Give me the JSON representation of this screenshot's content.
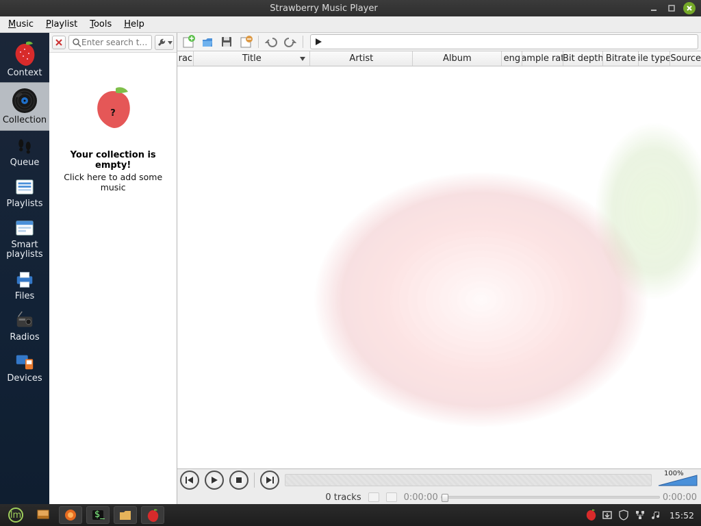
{
  "window": {
    "title": "Strawberry Music Player"
  },
  "menubar": {
    "music": "Music",
    "playlist": "Playlist",
    "tools": "Tools",
    "help": "Help"
  },
  "sidebar": {
    "items": [
      {
        "label": "Context"
      },
      {
        "label": "Collection"
      },
      {
        "label": "Queue"
      },
      {
        "label": "Playlists"
      },
      {
        "label": "Smart\nplaylists"
      },
      {
        "label": "Files"
      },
      {
        "label": "Radios"
      },
      {
        "label": "Devices"
      }
    ]
  },
  "collection": {
    "search_placeholder": "Enter search t…",
    "empty_title": "Your collection is empty!",
    "empty_sub": "Click here to add some music"
  },
  "columns": {
    "track": "rac",
    "title": "Title",
    "artist": "Artist",
    "album": "Album",
    "length": "eng",
    "samplerate": "ample rat",
    "bitdepth": "Bit depth",
    "bitrate": "Bitrate",
    "filetype": "ile type",
    "source": "Source"
  },
  "transport": {
    "track_count": "0 tracks",
    "time_elapsed": "0:00:00",
    "time_total": "0:00:00",
    "volume_label": "100%"
  },
  "taskbar": {
    "clock": "15:52"
  }
}
